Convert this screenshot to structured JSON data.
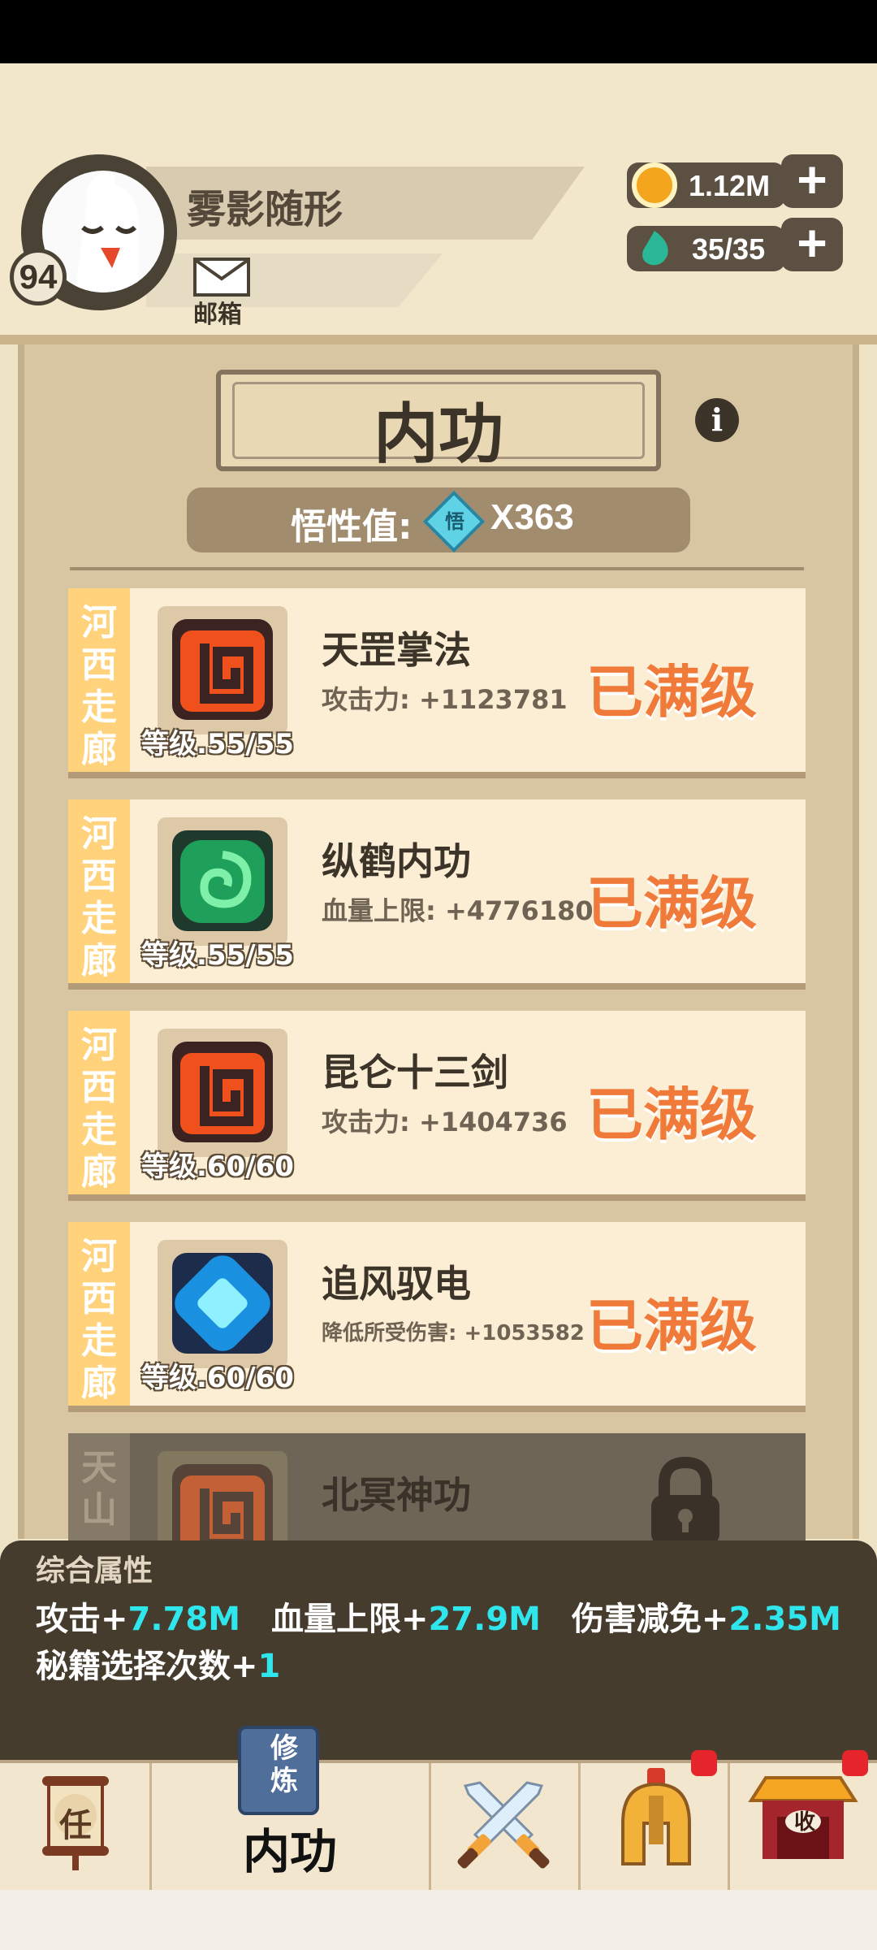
{
  "player": {
    "name": "雾影随形",
    "level": "94",
    "mailbox_label": "邮箱"
  },
  "resources": {
    "coins": "1.12M",
    "energy": "35/35"
  },
  "page": {
    "title": "内功",
    "wisdom_label": "悟性值:",
    "wisdom_gem_char": "悟",
    "wisdom_value": "X363"
  },
  "skills": [
    {
      "region": [
        "河",
        "西",
        "走",
        "廊"
      ],
      "name": "天罡掌法",
      "stat": "攻击力: +1123781",
      "level": "等级.55/55",
      "status": "已满级",
      "icon": "red-demon-icon"
    },
    {
      "region": [
        "河",
        "西",
        "走",
        "廊"
      ],
      "name": "纵鹤内功",
      "stat": "血量上限: +4776180",
      "level": "等级.55/55",
      "status": "已满级",
      "icon": "green-swirl-icon"
    },
    {
      "region": [
        "河",
        "西",
        "走",
        "廊"
      ],
      "name": "昆仑十三剑",
      "stat": "攻击力: +1404736",
      "level": "等级.60/60",
      "status": "已满级",
      "icon": "red-demon-icon"
    },
    {
      "region": [
        "河",
        "西",
        "走",
        "廊"
      ],
      "name": "追风驭电",
      "stat": "降低所受伤害: +1053582",
      "level": "等级.60/60",
      "status": "已满级",
      "icon": "blue-crystal-icon"
    },
    {
      "region": [
        "天",
        "山"
      ],
      "name": "北冥神功",
      "locked": true,
      "icon": "red-demon-icon"
    }
  ],
  "summary": {
    "title": "综合属性",
    "attack_label": "攻击+",
    "attack_value": "7.78M",
    "hp_label": "血量上限+",
    "hp_value": "27.9M",
    "reduce_label": "伤害减免+",
    "reduce_value": "2.35M",
    "secret_label": "秘籍选择次数+",
    "secret_value": "1"
  },
  "nav": {
    "items": [
      {
        "icon": "task-scroll-icon",
        "char": "任"
      },
      {
        "icon": "cultivate-book-icon",
        "book_text": "修炼",
        "label": "内功",
        "active": true
      },
      {
        "icon": "crossed-swords-icon"
      },
      {
        "icon": "helmet-icon",
        "badge": true
      },
      {
        "icon": "shop-icon",
        "char": "收",
        "badge": true
      }
    ]
  },
  "colors": {
    "status_orange": "#f07a3a",
    "value_cyan": "#2ee6ec",
    "tag_yellow": "#ffd27b"
  }
}
